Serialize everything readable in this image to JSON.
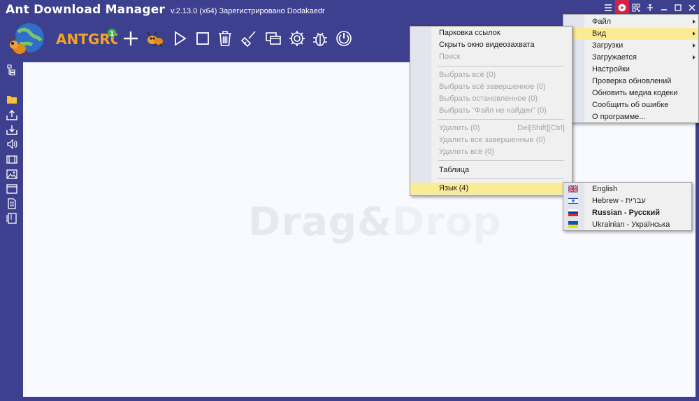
{
  "titlebar": {
    "app_title": "Ant Download Manager",
    "meta": "v.2.13.0  (x64)  Зарегистрировано Dodakaedr"
  },
  "window_controls": [
    "menu-icon",
    "record-icon",
    "qr-icon",
    "pin-icon",
    "minimize-icon",
    "maximize-icon",
    "close-icon"
  ],
  "toolbar": {
    "brand": "ANTGROUP",
    "buttons": [
      "add-icon",
      "ant-icon",
      "play-icon",
      "stop-icon",
      "trash-icon",
      "broom-icon",
      "windows-icon",
      "gear-icon",
      "bug-icon",
      "power-icon"
    ]
  },
  "sidebar": [
    "tree-icon",
    "folder-icon",
    "upload-icon",
    "download-icon",
    "audio-icon",
    "video-icon",
    "image-icon",
    "window-icon",
    "document-icon",
    "archive-icon"
  ],
  "main": {
    "drag_drop_a": "Drag&",
    "drag_drop_b": "Drop"
  },
  "main_menu": {
    "items": [
      {
        "label": "Файл",
        "submenu": true
      },
      {
        "label": "Вид",
        "submenu": true,
        "highlighted": true
      },
      {
        "label": "Загрузки",
        "submenu": true
      },
      {
        "label": "Загружается",
        "submenu": true
      },
      {
        "label": "Настройки"
      },
      {
        "label": "Проверка обновлений"
      },
      {
        "label": "Обновить медиа кодеки"
      },
      {
        "label": "Сообщить об ошибке"
      },
      {
        "label": "О программе..."
      }
    ]
  },
  "view_menu": {
    "items": [
      {
        "label": "Парковка ссылок"
      },
      {
        "label": "Скрыть окно видеозахвата"
      },
      {
        "label": "Поиск",
        "disabled": true
      },
      {
        "label": "Выбрать всё (0)",
        "disabled": true
      },
      {
        "label": "Выбрать всё завершенное (0)",
        "disabled": true
      },
      {
        "label": "Выбрать остановленное (0)",
        "disabled": true
      },
      {
        "label": "Выбрать \"Файл не найден\" (0)",
        "disabled": true
      },
      {
        "label": "Удалить (0)",
        "shortcut": "Del[Shift][Ctrl]",
        "disabled": true
      },
      {
        "label": "Удалить все завершенные (0)",
        "disabled": true
      },
      {
        "label": "Удалить всё (0)",
        "disabled": true
      },
      {
        "label": "Таблица"
      },
      {
        "label": "Язык (4)",
        "submenu": true,
        "highlighted": true
      }
    ]
  },
  "language_menu": {
    "items": [
      {
        "label": "English",
        "flag": "uk-flag-icon"
      },
      {
        "label": "Hebrew - עברית",
        "flag": "israel-flag-icon"
      },
      {
        "label": "Russian - Русский",
        "flag": "russia-flag-icon",
        "selected": true
      },
      {
        "label": "Ukrainian - Українська",
        "flag": "ukraine-flag-icon"
      }
    ]
  },
  "colors": {
    "background": "#3d3f8f",
    "highlight": "#fbeb95",
    "record": "#d4214a"
  }
}
